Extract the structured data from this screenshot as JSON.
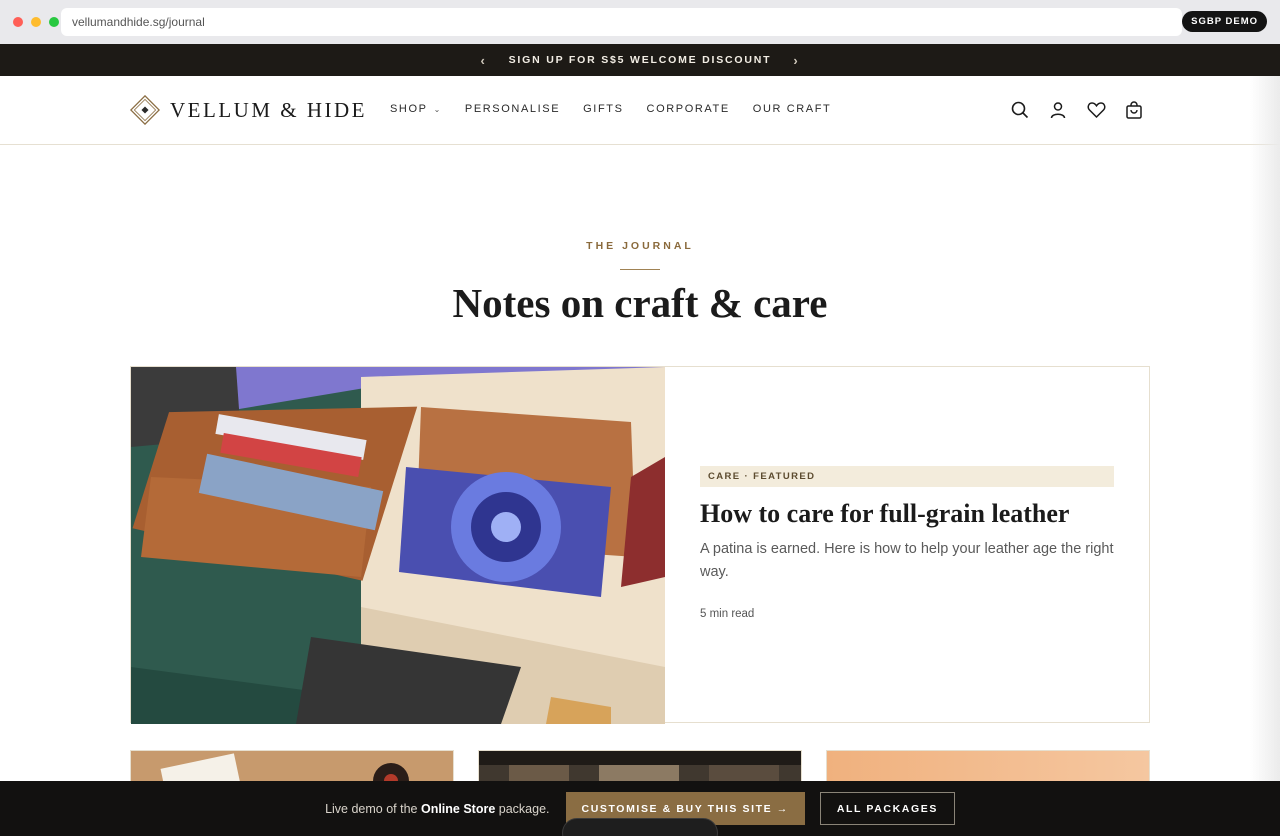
{
  "browser": {
    "url": "vellumandhide.sg/journal",
    "demo_badge": "SGBP DEMO"
  },
  "announcement": {
    "text": "SIGN UP FOR S$5 WELCOME DISCOUNT",
    "prev_icon": "chevron-left-icon",
    "next_icon": "chevron-right-icon"
  },
  "header": {
    "brand": "VELLUM & HIDE",
    "nav": [
      {
        "label": "SHOP",
        "has_dropdown": true
      },
      {
        "label": "PERSONALISE"
      },
      {
        "label": "GIFTS"
      },
      {
        "label": "CORPORATE"
      },
      {
        "label": "OUR CRAFT"
      }
    ],
    "icons": [
      "search-icon",
      "account-icon",
      "wishlist-icon",
      "cart-icon"
    ]
  },
  "hero": {
    "eyebrow": "THE JOURNAL",
    "title": "Notes on craft & care"
  },
  "featured": {
    "tag": "CARE · FEATURED",
    "title": "How to care for full-grain leather",
    "excerpt": "A patina is earned. Here is how to help your leather age the right way.",
    "meta": "5 min read"
  },
  "demo_bar": {
    "text_prefix": "Live demo of the ",
    "text_strong": "Online Store",
    "text_suffix": " package.",
    "primary_button": "CUSTOMISE & BUY THIS SITE →",
    "secondary_button": "ALL PACKAGES"
  },
  "colors": {
    "accent_gold": "#8a6d43",
    "eyebrow": "#8a6a3c",
    "announcement_bg": "#1d1a16",
    "tag_bg": "#f3ecdc"
  }
}
